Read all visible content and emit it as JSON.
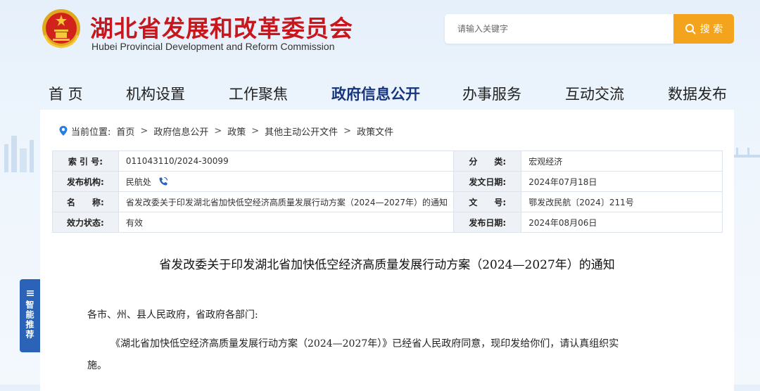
{
  "header": {
    "title": "湖北省发展和改革委员会",
    "subtitle": "Hubei Provincial Development and Reform Commission"
  },
  "search": {
    "placeholder": "请输入关键字",
    "button_label": "搜 索"
  },
  "nav": {
    "items": [
      {
        "label": "首 页"
      },
      {
        "label": "机构设置"
      },
      {
        "label": "工作聚焦"
      },
      {
        "label": "政府信息公开"
      },
      {
        "label": "办事服务"
      },
      {
        "label": "互动交流"
      },
      {
        "label": "数据发布"
      }
    ],
    "active": "政府信息公开"
  },
  "breadcrumb": {
    "prefix": "当前位置:",
    "items": [
      "首页",
      "政府信息公开",
      "政策",
      "其他主动公开文件",
      "政策文件"
    ],
    "separator": ">"
  },
  "info": {
    "index_label": "索 引 号:",
    "index_value": "011043110/2024-30099",
    "category_label": "分　　类:",
    "category_value": "宏观经济",
    "org_label": "发布机构:",
    "org_value": "民航处",
    "date_label": "发文日期:",
    "date_value": "2024年07月18日",
    "name_label": "名　　称:",
    "name_value": "省发改委关于印发湖北省加快低空经济高质量发展行动方案（2024—2027年）的通知",
    "docno_label": "文　　号:",
    "docno_value": "鄂发改民航〔2024〕211号",
    "status_label": "效力状态:",
    "status_value": "有效",
    "publish_label": "发布日期:",
    "publish_value": "2024年08月06日"
  },
  "document": {
    "title": "省发改委关于印发湖北省加快低空经济高质量发展行动方案（2024—2027年）的通知",
    "salutation": "各市、州、县人民政府，省政府各部门:",
    "para1_line1": "《湖北省加快低空经济高质量发展行动方案（2024—2027年）》已经省人民政府同意，现印发给你们，请认真组织实",
    "para1_line2": "施。"
  },
  "side_tab": {
    "label": "智能推荐"
  },
  "colors": {
    "brand_red": "#c8161d",
    "nav_active": "#17357d",
    "search_button": "#f4a41c",
    "side_tab": "#2a63b8",
    "pin": "#2a7de1"
  }
}
